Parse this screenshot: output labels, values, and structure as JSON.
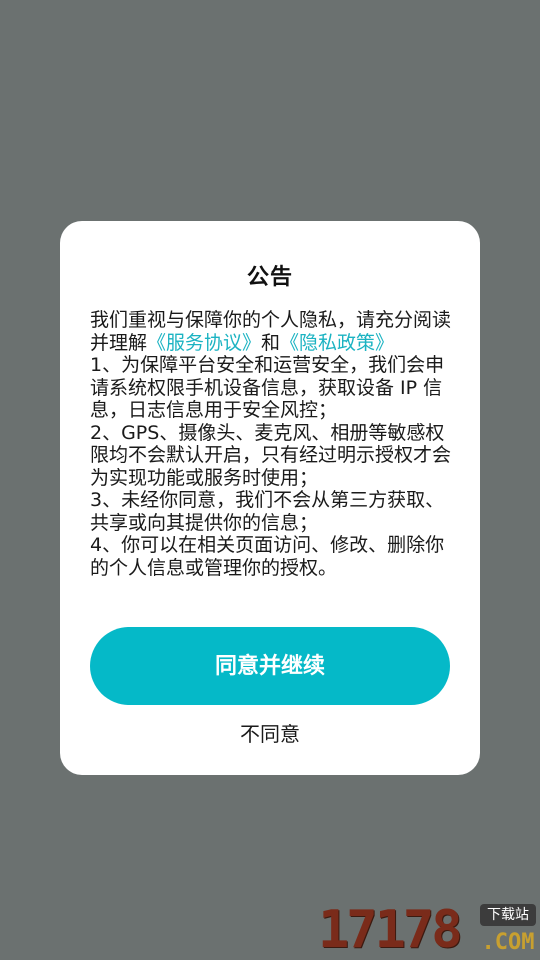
{
  "dialog": {
    "title": "公告",
    "intro_before": "我们重视与保障你的个人隐私，请充分阅读并理解",
    "service_agreement_link": "《服务协议》",
    "intro_and": "和",
    "privacy_policy_link": "《隐私政策》",
    "items": [
      "1、为保障平台安全和运营安全，我们会申请系统权限手机设备信息，获取设备 IP 信息，日志信息用于安全风控；",
      "2、GPS、摄像头、麦克风、相册等敏感权限均不会默认开启，只有经过明示授权才会为实现功能或服务时使用；",
      "3、未经你同意，我们不会从第三方获取、共享或向其提供你的信息；",
      "4、你可以在相关页面访问、修改、删除你的个人信息或管理你的授权。"
    ],
    "agree_label": "同意并继续",
    "disagree_label": "不同意"
  },
  "watermark": {
    "number": "17178",
    "badge": "下载站",
    "domain": ".COM"
  },
  "colors": {
    "backdrop": "#6b7170",
    "accent": "#05b9c8",
    "link": "#1bb3c2"
  }
}
